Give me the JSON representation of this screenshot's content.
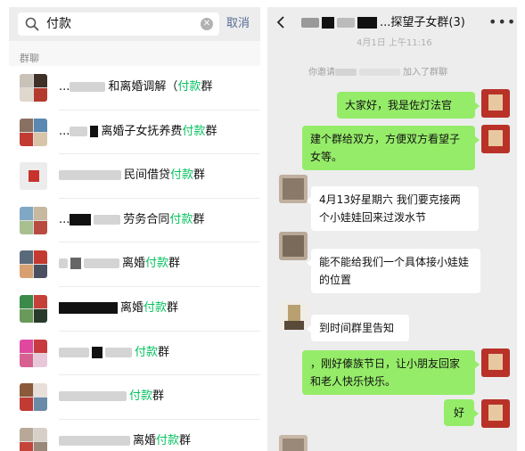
{
  "search": {
    "query": "付款",
    "cancel_label": "取消",
    "section_label": "群聊",
    "results": [
      {
        "prefix": "...",
        "text": "和离婚调解（",
        "highlight": "付款",
        "suffix": "群"
      },
      {
        "prefix": "...",
        "text": "离婚子女抚养费",
        "highlight": "付款",
        "suffix": "群"
      },
      {
        "prefix": "",
        "text": "民间借贷",
        "highlight": "付款",
        "suffix": "群"
      },
      {
        "prefix": "...",
        "text": "劳务合同",
        "highlight": "付款",
        "suffix": "群"
      },
      {
        "prefix": "",
        "text": "离婚",
        "highlight": "付款",
        "suffix": "群"
      },
      {
        "prefix": "",
        "text": "离婚",
        "highlight": "付款",
        "suffix": "群"
      },
      {
        "prefix": "",
        "text": "",
        "highlight": "付款",
        "suffix": "群"
      },
      {
        "prefix": "",
        "text": "",
        "highlight": "付款",
        "suffix": "群"
      },
      {
        "prefix": "",
        "text": "离婚",
        "highlight": "付款",
        "suffix": "群"
      }
    ]
  },
  "chat": {
    "title": "...探望子女群(3)",
    "timestamp": "4月1日 上午11:16",
    "system_prefix": "你邀请",
    "system_suffix": "加入了群聊",
    "messages": [
      {
        "side": "me",
        "text": "大家好，我是佐灯法官"
      },
      {
        "side": "me",
        "text": "建个群给双方，方便双方看望子女等。"
      },
      {
        "side": "other",
        "text": "4月13好星期六 我们要克接两个小娃娃回来过泼水节"
      },
      {
        "side": "other",
        "text": "能不能给我们一个具体接小娃娃的位置"
      },
      {
        "side": "other",
        "text": "到时间群里告知"
      },
      {
        "side": "me",
        "text": "，刚好傣族节日，让小朋友回家和老人快乐快乐。"
      },
      {
        "side": "me",
        "text": "好"
      }
    ]
  },
  "colors": {
    "highlight": "#07c160",
    "bubble_me": "#95ec69",
    "bubble_other": "#ffffff",
    "link": "#576b95"
  }
}
